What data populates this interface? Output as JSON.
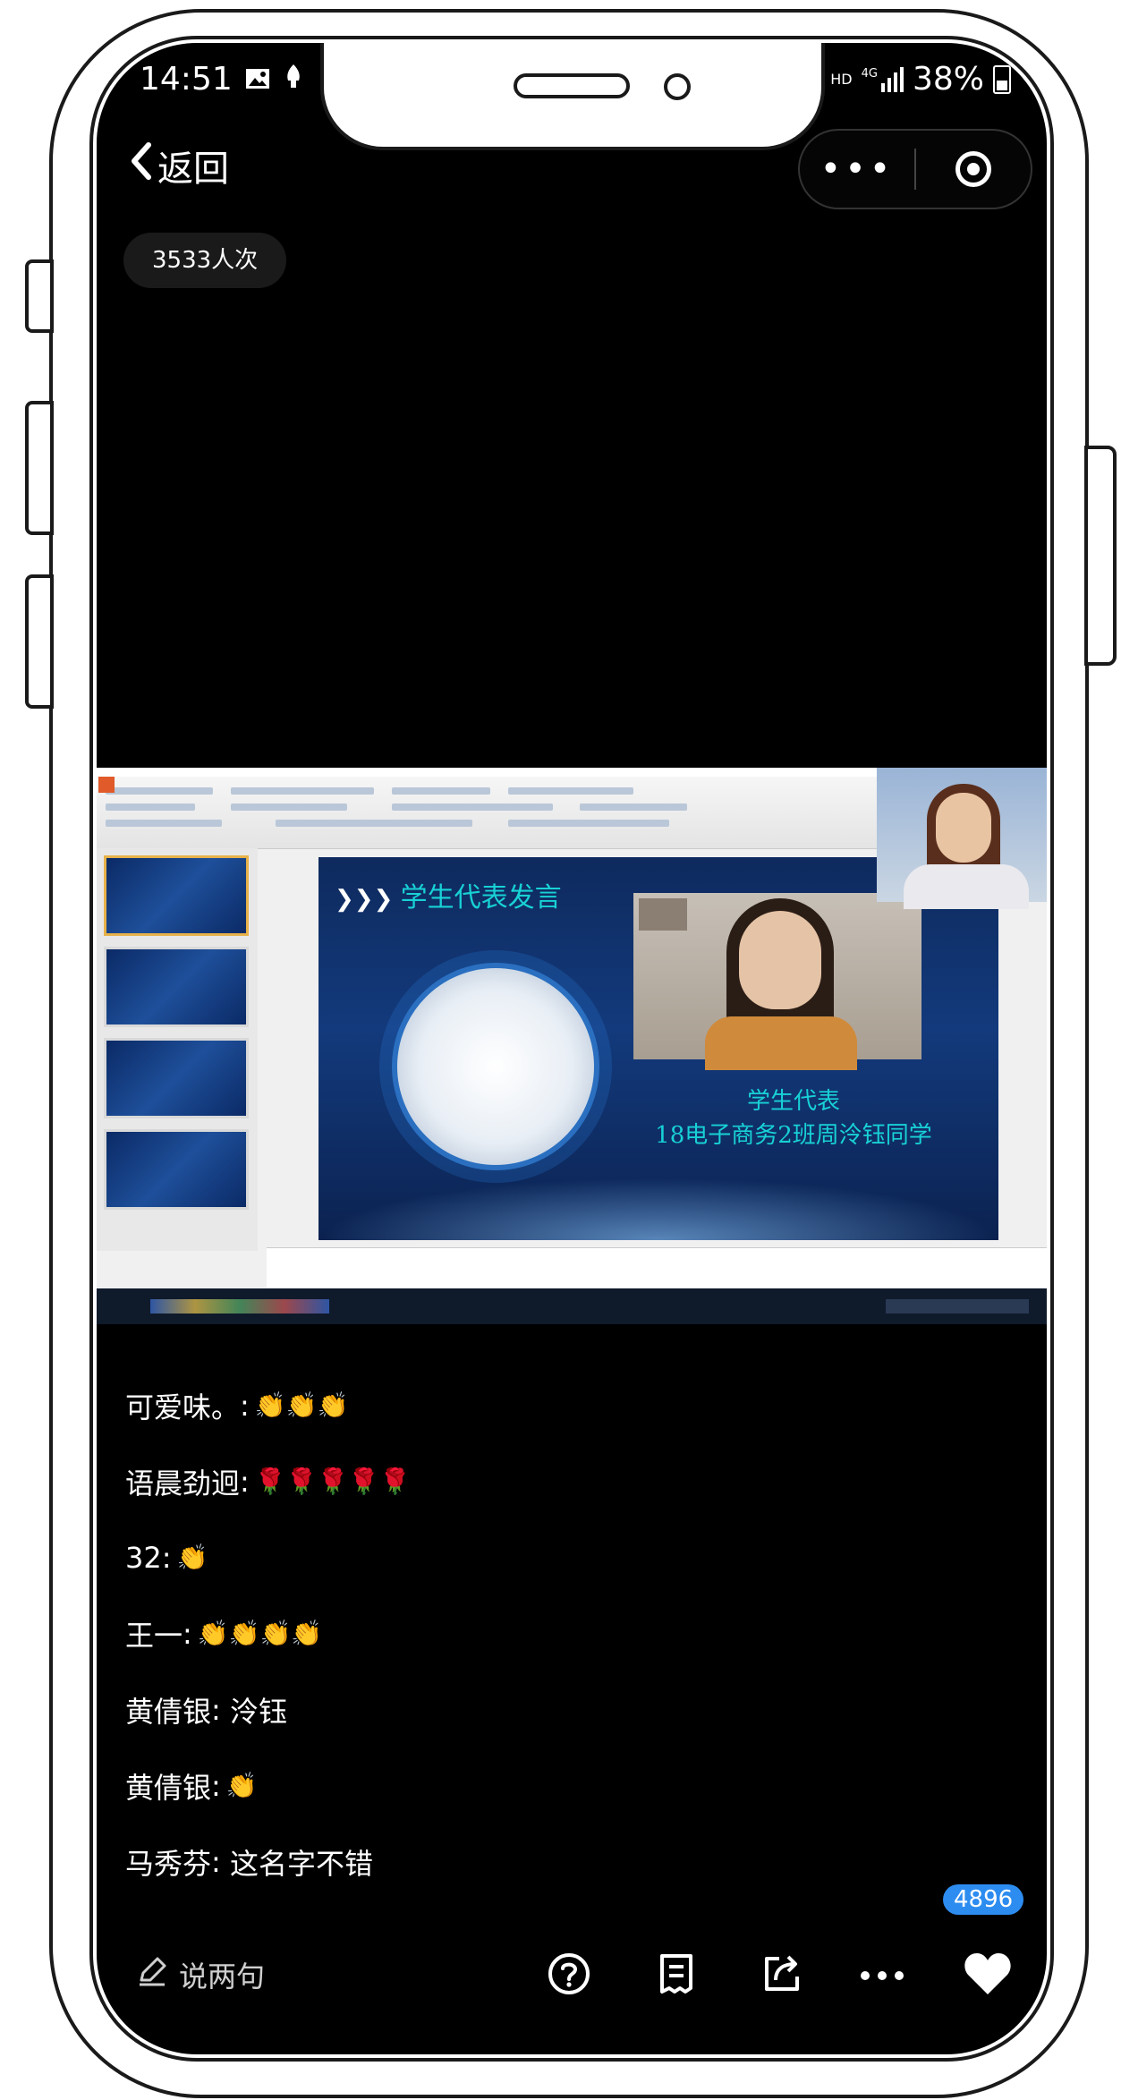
{
  "status_bar": {
    "time": "14:51",
    "network": "4G",
    "battery": "38%",
    "hd": "HD"
  },
  "nav": {
    "back_label": "返回",
    "more_label": "•••"
  },
  "viewer_count": "3533人次",
  "video": {
    "slide_title": "学生代表发言",
    "caption_line1": "学生代表",
    "caption_line2": "18电子商务2班周泠钰同学"
  },
  "comments": [
    {
      "user": "可爱味。",
      "text": "",
      "emoji": "👏👏👏"
    },
    {
      "user": "语晨劲迥",
      "text": "",
      "emoji": "🌹🌹🌹🌹🌹"
    },
    {
      "user": "32",
      "text": "",
      "emoji": "👏"
    },
    {
      "user": "王一",
      "text": "",
      "emoji": "👏👏👏👏"
    },
    {
      "user": "黄倩银",
      "text": "泠钰",
      "emoji": ""
    },
    {
      "user": "黄倩银",
      "text": "",
      "emoji": "👏"
    },
    {
      "user": "马秀芬",
      "text": "这名字不错",
      "emoji": ""
    }
  ],
  "bottom": {
    "say_label": "说两句",
    "like_count": "4896"
  },
  "icons": {
    "back": "chevron-left-icon",
    "more": "more-dots-icon",
    "close": "target-close-icon",
    "help": "help-circle-icon",
    "notes": "notes-icon",
    "share": "share-icon",
    "more_actions": "more-dots-icon",
    "like": "heart-icon",
    "edit": "pencil-icon"
  },
  "colors": {
    "screen_bg": "#000000",
    "accent_badge": "#2d8cf0",
    "slide_text": "#18d1d6"
  }
}
